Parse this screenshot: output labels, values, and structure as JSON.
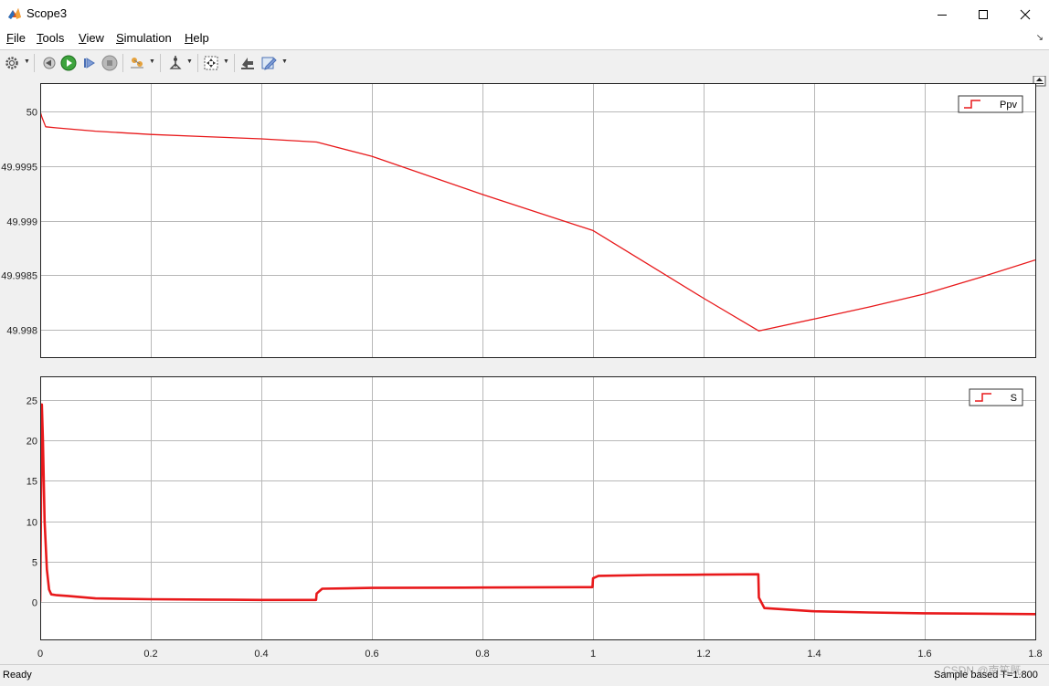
{
  "window": {
    "title": "Scope3"
  },
  "menu": {
    "items": [
      {
        "key": "F",
        "rest": "ile"
      },
      {
        "key": "T",
        "rest": "ools"
      },
      {
        "key": "V",
        "rest": "iew"
      },
      {
        "key": "S",
        "rest": "imulation"
      },
      {
        "key": "H",
        "rest": "elp"
      }
    ]
  },
  "toolbar": {
    "icons": [
      "settings-icon",
      "step-back-icon",
      "run-icon",
      "step-forward-icon",
      "stop-icon",
      "highlight-icon",
      "cursor-icon",
      "autoscale-icon",
      "style-icon",
      "edit-icon"
    ]
  },
  "status": {
    "left": "Ready",
    "right": "Sample based  T=1.800"
  },
  "watermark": "CSDN @南笙既",
  "colors": {
    "trace": "#e8191b",
    "grid": "#b8b8b8",
    "axes_bg": "#ffffff"
  },
  "chart_data": [
    {
      "type": "line",
      "title": "",
      "xlim": [
        0,
        1.8
      ],
      "ylim": [
        49.99775,
        50.00026
      ],
      "xticks": [
        0,
        0.2,
        0.4,
        0.6,
        0.8,
        1,
        1.2,
        1.4,
        1.6,
        1.8
      ],
      "yticks": [
        49.998,
        49.9985,
        49.999,
        49.9995,
        50
      ],
      "ytick_labels": [
        "49.998",
        "49.9985",
        "49.999",
        "49.9995",
        "50"
      ],
      "grid": true,
      "legend": "top-right",
      "series": [
        {
          "name": "Ppv",
          "x": [
            0,
            0.003,
            0.01,
            0.03,
            0.1,
            0.2,
            0.3,
            0.4,
            0.5,
            0.6,
            0.8,
            1.0,
            1.1,
            1.2,
            1.3,
            1.4,
            1.5,
            1.6,
            1.7,
            1.8
          ],
          "y": [
            50.0,
            49.99995,
            49.99986,
            49.99985,
            49.99982,
            49.99979,
            49.99977,
            49.99975,
            49.99972,
            49.99959,
            49.99924,
            49.99891,
            49.9986,
            49.99829,
            49.99799,
            49.9981,
            49.99821,
            49.99833,
            49.99848,
            49.99864
          ]
        }
      ]
    },
    {
      "type": "line",
      "title": "",
      "xlim": [
        0,
        1.8
      ],
      "ylim": [
        -4.7,
        28
      ],
      "xticks": [
        0,
        0.2,
        0.4,
        0.6,
        0.8,
        1,
        1.2,
        1.4,
        1.6,
        1.8
      ],
      "xtick_labels": [
        "0",
        "0.2",
        "0.4",
        "0.6",
        "0.8",
        "1",
        "1.2",
        "1.4",
        "1.6",
        "1.8"
      ],
      "yticks": [
        0,
        5,
        10,
        15,
        20,
        25
      ],
      "ytick_labels": [
        "0",
        "5",
        "10",
        "15",
        "20",
        "25"
      ],
      "grid": true,
      "legend": "top-right",
      "series": [
        {
          "name": "S",
          "x": [
            0,
            0.003,
            0.005,
            0.008,
            0.012,
            0.016,
            0.02,
            0.03,
            0.05,
            0.1,
            0.2,
            0.3,
            0.4,
            0.499,
            0.5,
            0.51,
            0.6,
            0.8,
            0.999,
            1.0,
            1.01,
            1.1,
            1.2,
            1.299,
            1.3,
            1.31,
            1.4,
            1.5,
            1.6,
            1.7,
            1.8
          ],
          "y": [
            0,
            24.5,
            20,
            10,
            4,
            1.5,
            0.9,
            0.8,
            0.7,
            0.4,
            0.3,
            0.25,
            0.2,
            0.2,
            1.0,
            1.6,
            1.7,
            1.75,
            1.8,
            2.9,
            3.2,
            3.3,
            3.35,
            3.4,
            0.5,
            -0.8,
            -1.2,
            -1.35,
            -1.45,
            -1.5,
            -1.55
          ]
        }
      ]
    }
  ]
}
